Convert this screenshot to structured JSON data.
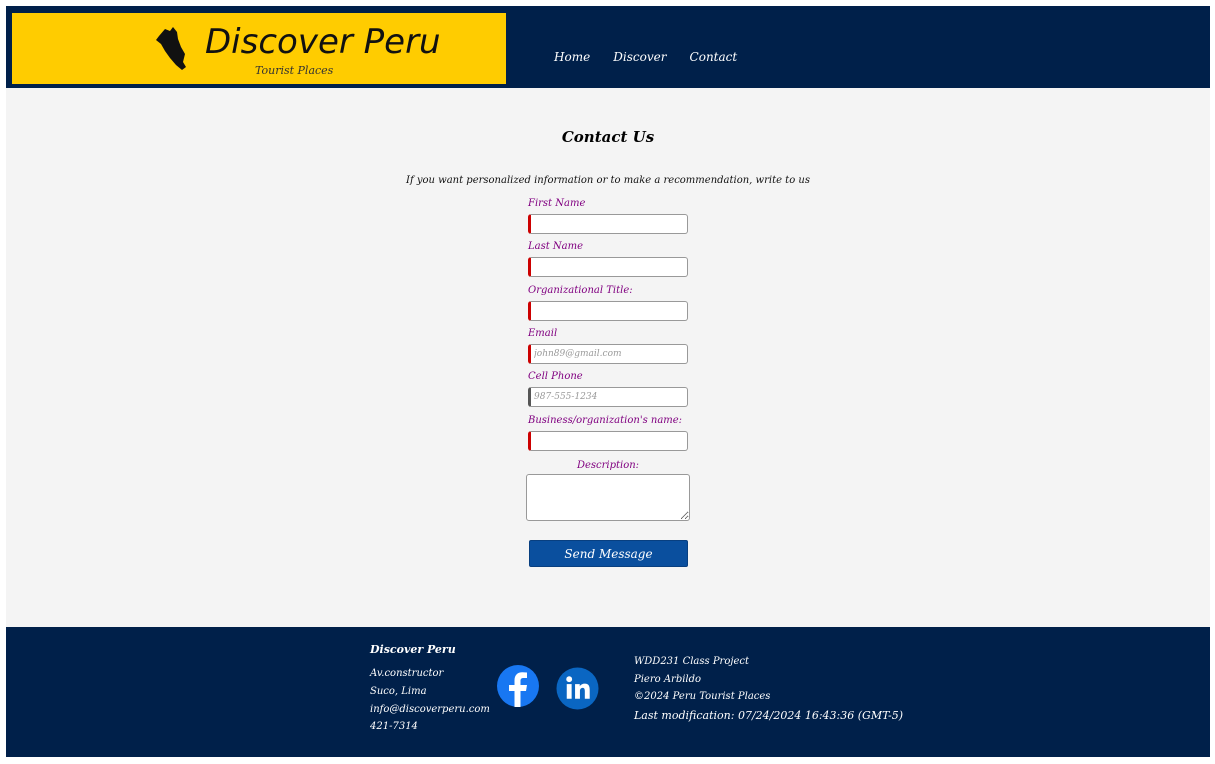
{
  "header": {
    "brand_title": "Discover Peru",
    "brand_subtitle": "Tourist Places",
    "nav": [
      "Home",
      "Discover",
      "Contact"
    ]
  },
  "main": {
    "title": "Contact Us",
    "intro": "If you want personalized information or to make a recommendation, write to us",
    "fields": {
      "first_name": {
        "label": "First Name",
        "value": "",
        "placeholder": ""
      },
      "last_name": {
        "label": "Last Name",
        "value": "",
        "placeholder": ""
      },
      "org_title": {
        "label": "Organizational Title:",
        "value": "",
        "placeholder": ""
      },
      "email": {
        "label": "Email",
        "value": "",
        "placeholder": "john89@gmail.com"
      },
      "cell_phone": {
        "label": "Cell Phone",
        "value": "",
        "placeholder": "987-555-1234"
      },
      "business": {
        "label": "Business/organization's name:",
        "value": "",
        "placeholder": ""
      }
    },
    "description_label": "Description:",
    "submit_label": "Send Message"
  },
  "footer": {
    "title": "Discover Peru",
    "address_lines": [
      "Av.constructor",
      "Suco, Lima",
      "info@discoverperu.com",
      "421-7314"
    ],
    "social": [
      "facebook-icon",
      "linkedin-icon"
    ],
    "right_lines": [
      "WDD231 Class Project",
      "Piero Arbildo",
      "©2024 Peru Tourist Places",
      "Last modification: 07/24/2024 16:43:36 (GMT-5)"
    ]
  },
  "colors": {
    "navy": "#00204a",
    "brand_yellow": "#ffcc00",
    "label_purple": "#800080",
    "required_red": "#cc0000",
    "button_blue": "#0a4f9e",
    "facebook_blue": "#1877f2",
    "linkedin_blue": "#0a66c2"
  }
}
